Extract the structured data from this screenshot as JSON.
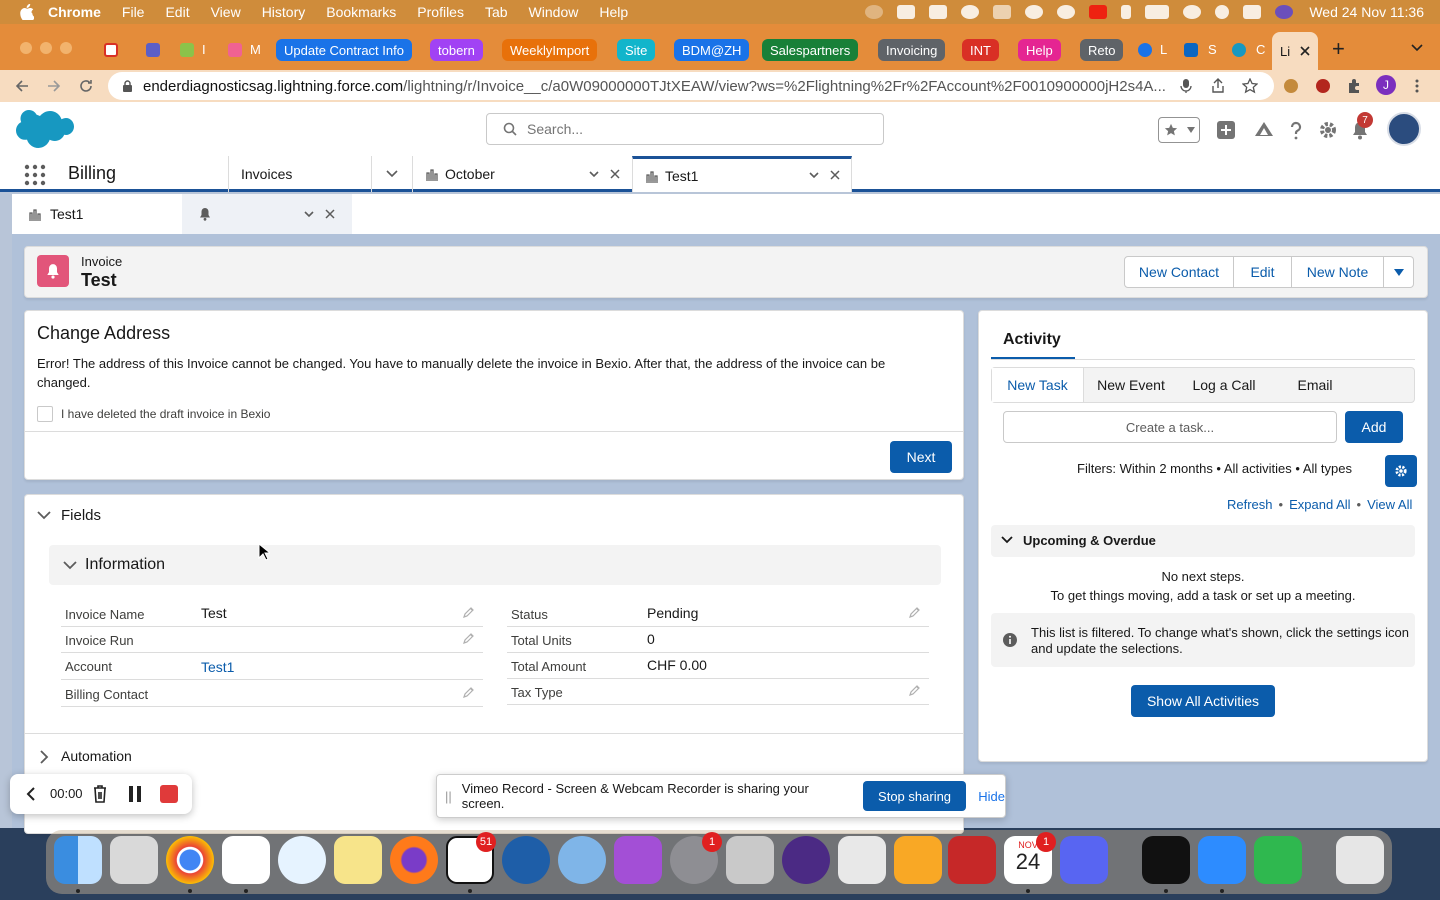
{
  "menubar": {
    "app": "Chrome",
    "items": [
      "File",
      "Edit",
      "View",
      "History",
      "Bookmarks",
      "Profiles",
      "Tab",
      "Window",
      "Help"
    ],
    "clock": "Wed 24 Nov  11:36"
  },
  "browser": {
    "tab_groups": [
      {
        "label": "Update Contract Info",
        "color": "#1a73e8"
      },
      {
        "label": "tobern",
        "color": "#a142f4"
      },
      {
        "label": "WeeklyImport",
        "color": "#e8710a"
      },
      {
        "label": "Site",
        "color": "#12b5cb"
      },
      {
        "label": "BDM@ZH",
        "color": "#1a73e8"
      },
      {
        "label": "Salespartners",
        "color": "#188038"
      },
      {
        "label": "Invoicing",
        "color": "#5f6368"
      },
      {
        "label": "INT",
        "color": "#d93025"
      },
      {
        "label": "Help",
        "color": "#e52592"
      },
      {
        "label": "Reto",
        "color": "#5f6368"
      }
    ],
    "small_tabs": [
      "I",
      "M",
      "L",
      "S",
      "C"
    ],
    "active_tab": "Li",
    "url_host": "enderdiagnosticsag.lightning.force.com",
    "url_path": "/lightning/r/Invoice__c/a0W09000000TJtXEAW/view?ws=%2Flightning%2Fr%2FAccount%2F0010900000jH2s4A..."
  },
  "sf": {
    "search_placeholder": "Search...",
    "notification_count": "7",
    "app_name": "Billing",
    "nav_tabs": [
      {
        "label": "Invoices"
      },
      {
        "label": "October"
      },
      {
        "label": "Test1"
      }
    ],
    "subtabs": [
      {
        "label": "Test1"
      },
      {
        "label": ""
      }
    ],
    "record": {
      "object": "Invoice",
      "name": "Test",
      "actions": [
        "New Contact",
        "Edit",
        "New Note"
      ]
    },
    "change_address": {
      "title": "Change Address",
      "error": "Error! The address of this Invoice cannot be changed. You have to manually delete the invoice in Bexio. After that, the address of the invoice can be changed.",
      "checkbox_label": "I have deleted the draft invoice in Bexio",
      "next": "Next"
    },
    "fields": {
      "section": "Fields",
      "subsection": "Information",
      "left": [
        {
          "label": "Invoice Name",
          "value": "Test"
        },
        {
          "label": "Invoice Run",
          "value": ""
        },
        {
          "label": "Account",
          "value": "Test1"
        },
        {
          "label": "Billing Contact",
          "value": ""
        }
      ],
      "right": [
        {
          "label": "Status",
          "value": "Pending"
        },
        {
          "label": "Total Units",
          "value": "0"
        },
        {
          "label": "Total Amount",
          "value": "CHF 0.00"
        },
        {
          "label": "Tax Type",
          "value": ""
        }
      ],
      "automation": "Automation"
    },
    "activity": {
      "title": "Activity",
      "tabs": [
        "New Task",
        "New Event",
        "Log a Call",
        "Email"
      ],
      "task_placeholder": "Create a task...",
      "add": "Add",
      "filters": "Filters: Within 2 months • All activities • All types",
      "links": [
        "Refresh",
        "Expand All",
        "View All"
      ],
      "upcoming": "Upcoming & Overdue",
      "no_steps": "No next steps.",
      "no_steps_sub": "To get things moving, add a task or set up a meeting.",
      "filtered_note": "This list is filtered. To change what's shown, click the settings icon and update the selections.",
      "show_all": "Show All Activities"
    }
  },
  "recorder": {
    "time": "00:00"
  },
  "sharebar": {
    "text": "Vimeo Record - Screen & Webcam Recorder is sharing your screen.",
    "stop": "Stop sharing",
    "hide": "Hide"
  },
  "dock": {
    "notion_badge": "51",
    "settings_badge": "1",
    "calendar_month": "NOV",
    "calendar_day": "24",
    "calendar_badge": "1"
  }
}
